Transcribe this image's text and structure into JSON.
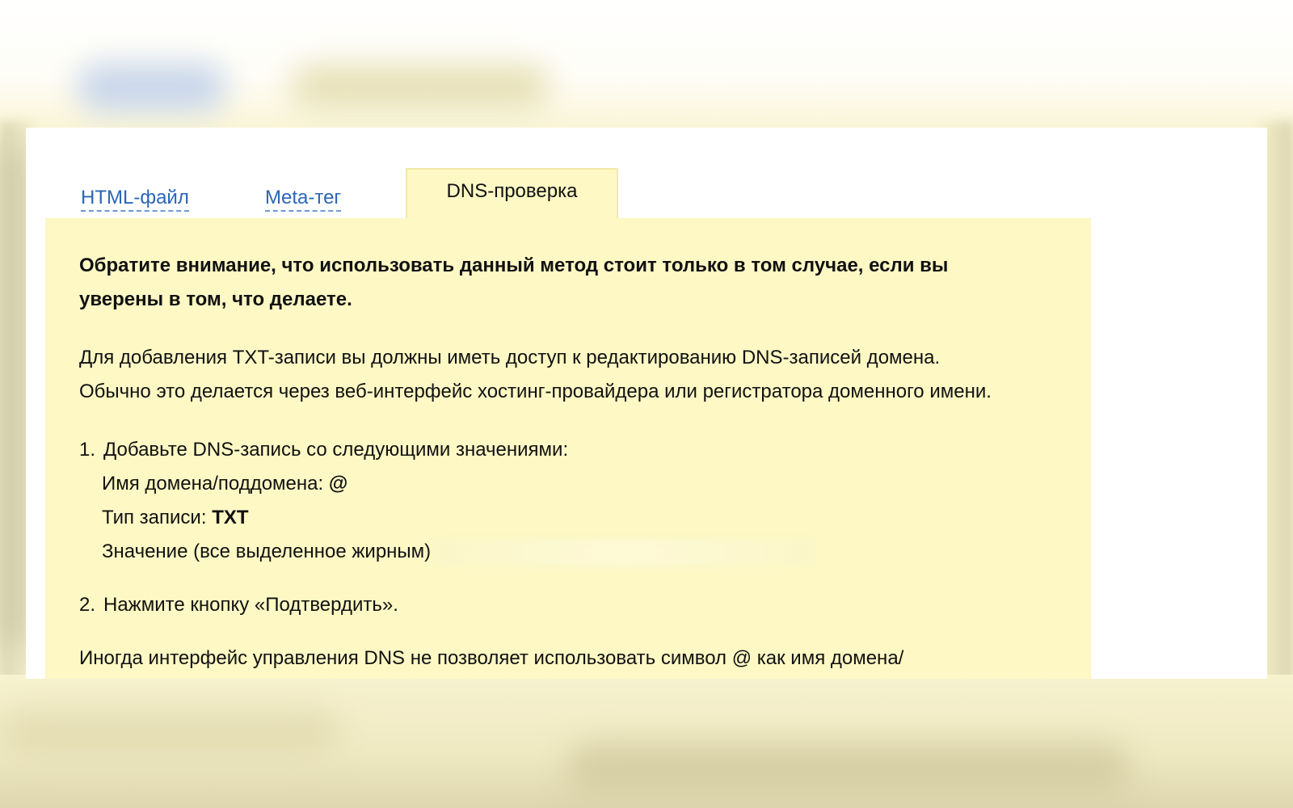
{
  "tabs": {
    "html_file": "HTML-файл",
    "meta_tag": "Meta-тег",
    "dns_check": "DNS-проверка"
  },
  "content": {
    "warning": "Обратите внимание, что использовать данный метод стоит только в том случае, если вы уверены в том, что делаете.",
    "intro_line1": "Для добавления TXT-записи вы должны иметь доступ к редактированию DNS-записей домена.",
    "intro_line2": "Обычно это делается через веб-интерфейс хостинг-провайдера или регистратора доменного имени.",
    "step1_num": "1.",
    "step1_text": "Добавьте DNS-запись со следующими значениями:",
    "domain_label": "Имя домена/поддомена:",
    "domain_value": "@",
    "type_label": "Тип записи:",
    "type_value": "TXT",
    "value_label": "Значение (все выделенное жирным)",
    "step2_num": "2.",
    "step2_text": "Нажмите кнопку «Подтвердить».",
    "note": "Иногда интерфейс управления DNS не позволяет использовать символ @ как имя домена/"
  },
  "colors": {
    "link": "#2a66b5",
    "active_tab_bg": "#fdf8c4",
    "content_bg": "#fdf8c4",
    "border": "#f2e9a8"
  }
}
